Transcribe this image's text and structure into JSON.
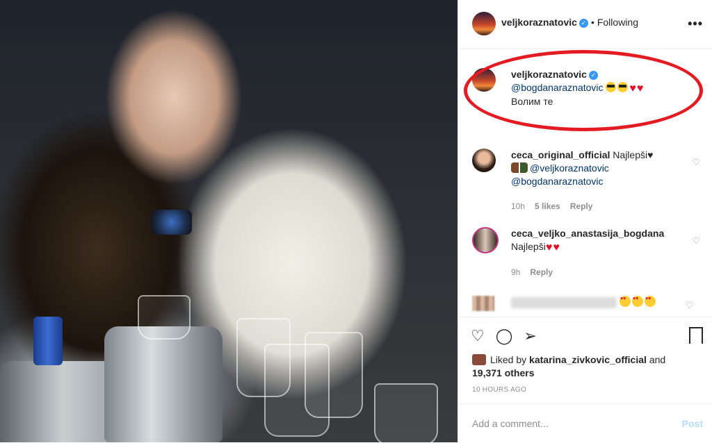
{
  "header": {
    "username": "veljkoraznatovic",
    "separator": "•",
    "follow_status": "Following",
    "more_glyph": "•••"
  },
  "caption": {
    "username": "veljkoraznatovic",
    "mention": "@bogdanaraznatovic",
    "text": "Волим те"
  },
  "comments": [
    {
      "username": "ceca_original_official",
      "text": "Najlepši",
      "mention1": "@veljkoraznatovic",
      "mention2": "@bogdanaraznatovic",
      "time": "10h",
      "likes": "5 likes",
      "reply": "Reply"
    },
    {
      "username": "ceca_veljko_anastasija_bogdana",
      "text": "Najlepši",
      "time": "9h",
      "reply": "Reply"
    }
  ],
  "actions": {
    "like_icon": "heart-outline-icon",
    "comment_icon": "comment-icon",
    "share_icon": "share-icon",
    "save_icon": "bookmark-icon"
  },
  "likes": {
    "prefix": "Liked by",
    "user": "katarina_zivkovic_official",
    "and": "and",
    "others": "19,371 others"
  },
  "timestamp": "10 HOURS AGO",
  "add_comment": {
    "placeholder": "Add a comment...",
    "post_label": "Post"
  },
  "colors": {
    "highlight_ring": "#e31b23",
    "link": "#003569",
    "verified": "#3897f0",
    "post_disabled": "#b2dffc"
  }
}
